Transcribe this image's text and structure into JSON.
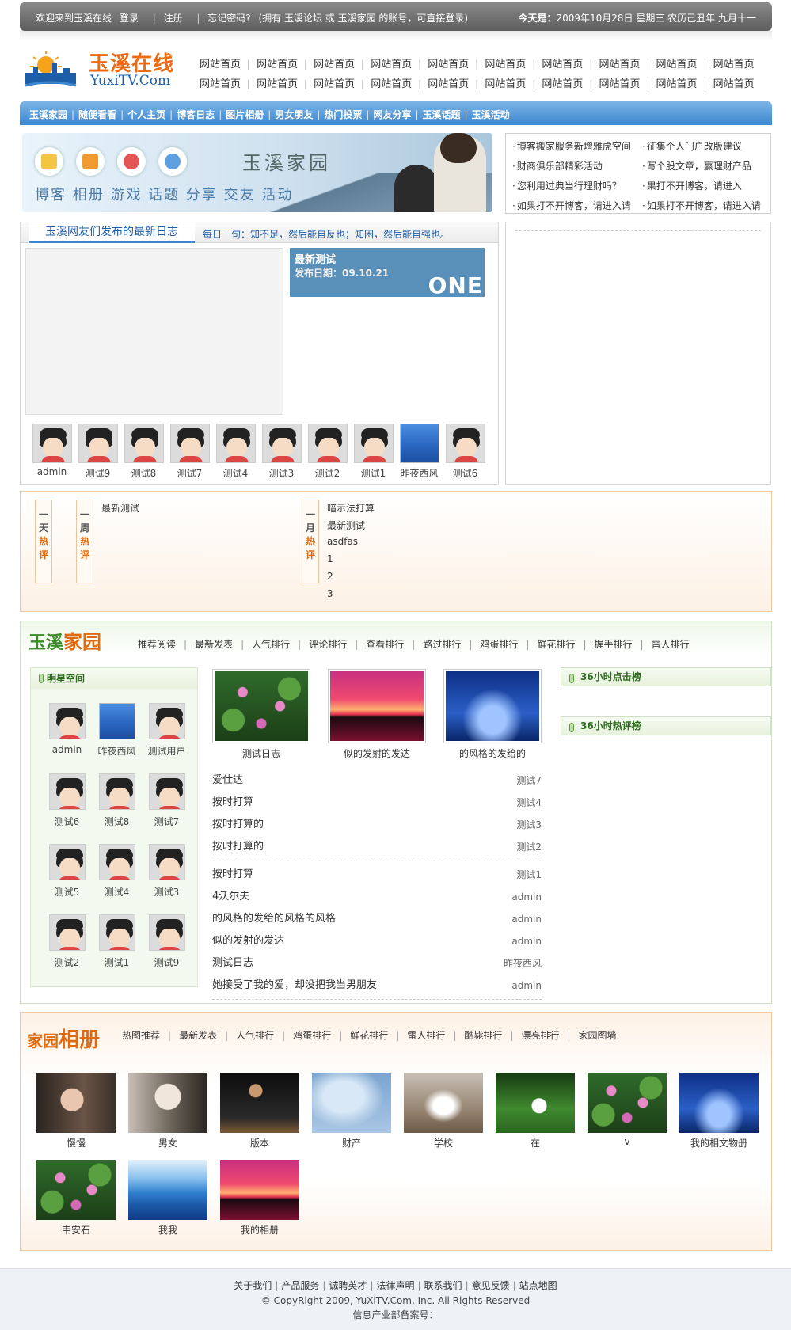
{
  "topbar": {
    "welcome": "欢迎来到玉溪在线",
    "login": "登录",
    "register": "注册",
    "forgot": "忘记密码?",
    "hint": "(拥有 玉溪论坛 或 玉溪家园 的账号，可直接登录)",
    "today_label": "今天是：",
    "today_value": "2009年10月28日 星期三 农历己丑年 九月十一"
  },
  "logo": {
    "cn": "玉溪在线",
    "en": "YuxiTV.Com"
  },
  "top_links": [
    [
      "网站首页",
      "网站首页",
      "网站首页",
      "网站首页",
      "网站首页",
      "网站首页",
      "网站首页",
      "网站首页",
      "网站首页",
      "网站首页"
    ],
    [
      "网站首页",
      "网站首页",
      "网站首页",
      "网站首页",
      "网站首页",
      "网站首页",
      "网站首页",
      "网站首页",
      "网站首页",
      "网站首页"
    ]
  ],
  "blue_nav": [
    "玉溪家园",
    "随便看看",
    "个人主页",
    "博客日志",
    "图片相册",
    "男女朋友",
    "热门投票",
    "网友分享",
    "玉溪话题",
    "玉溪活动"
  ],
  "banner": {
    "title": "玉溪家园",
    "words": "博客 相册 游戏 话题 分享 交友 活动"
  },
  "notice": {
    "left": [
      "博客搬家服务新增雅虎空间",
      "财商俱乐部精彩活动",
      "您利用过典当行理财吗？",
      "如果打不开博客，请进入请"
    ],
    "right": [
      "征集个人门户改版建议",
      "写个股文章，赢理财产品",
      "果打不开博客，请进入",
      "如果打不开博客，请进入请"
    ]
  },
  "latest": {
    "tab": "玉溪网友们发布的最新日志",
    "quote": "每日一句：知不足，然后能自反也；知困，然后能自强也。",
    "card_title": "最新测试",
    "card_date_label": "发布日期：",
    "card_date": "09.10.21",
    "card_badge": "ONE",
    "users": [
      {
        "name": "admin",
        "blue": false
      },
      {
        "name": "测试9",
        "blue": false
      },
      {
        "name": "测试8",
        "blue": false
      },
      {
        "name": "测试7",
        "blue": false
      },
      {
        "name": "测试4",
        "blue": false
      },
      {
        "name": "测试3",
        "blue": false
      },
      {
        "name": "测试2",
        "blue": false
      },
      {
        "name": "测试1",
        "blue": false
      },
      {
        "name": "昨夜西风",
        "blue": true
      },
      {
        "name": "测试6",
        "blue": false
      }
    ]
  },
  "hot": {
    "day_tag": [
      "一",
      "天",
      "热",
      "评"
    ],
    "week_tag": [
      "一",
      "周",
      "热",
      "评"
    ],
    "month_tag": [
      "一",
      "月",
      "热",
      "评"
    ],
    "week_list": [
      "最新测试"
    ],
    "month_list": [
      "暗示法打算",
      "最新测试",
      "asdfas",
      "1",
      "2",
      "3"
    ]
  },
  "home": {
    "logo_a": "玉溪",
    "logo_b": "家园",
    "tabs": [
      "推荐阅读",
      "最新发表",
      "人气排行",
      "评论排行",
      "查看排行",
      "路过排行",
      "鸡蛋排行",
      "鲜花排行",
      "握手排行",
      "雷人排行"
    ],
    "stars_title": "明星空间",
    "stars": [
      {
        "name": "admin",
        "blue": false
      },
      {
        "name": "昨夜西风",
        "blue": true
      },
      {
        "name": "测试用户",
        "blue": false
      },
      {
        "name": "测试6",
        "blue": false
      },
      {
        "name": "测试8",
        "blue": false
      },
      {
        "name": "测试7",
        "blue": false
      },
      {
        "name": "测试5",
        "blue": false
      },
      {
        "name": "测试4",
        "blue": false
      },
      {
        "name": "测试3",
        "blue": false
      },
      {
        "name": "测试2",
        "blue": false
      },
      {
        "name": "测试1",
        "blue": false
      },
      {
        "name": "测试9",
        "blue": false
      }
    ],
    "photos": [
      {
        "cap": "测试日志",
        "style": "lotus"
      },
      {
        "cap": "似的发射的发达",
        "style": "sunset"
      },
      {
        "cap": "的风格的发给的",
        "style": "bluefield"
      }
    ],
    "list_a": [
      {
        "t": "爱仕达",
        "a": "测试7"
      },
      {
        "t": "按时打算",
        "a": "测试4"
      },
      {
        "t": "按时打算的",
        "a": "测试3"
      },
      {
        "t": "按时打算的",
        "a": "测试2"
      }
    ],
    "list_b": [
      {
        "t": "按时打算",
        "a": "测试1"
      },
      {
        "t": "4沃尔夫",
        "a": "admin"
      },
      {
        "t": "的风格的发给的风格的风格",
        "a": "admin"
      },
      {
        "t": "似的发射的发达",
        "a": "admin"
      },
      {
        "t": "测试日志",
        "a": "昨夜西风"
      },
      {
        "t": "她接受了我的爱，却没把我当男朋友",
        "a": "admin"
      }
    ],
    "rank_click": "36小时点击榜",
    "rank_comment": "36小时热评榜"
  },
  "album": {
    "logo_a": "家园",
    "logo_b": "相册",
    "tabs": [
      "热图推荐",
      "最新发表",
      "人气排行",
      "鸡蛋排行",
      "鲜花排行",
      "雷人排行",
      "酷毙排行",
      "漂亮排行",
      "家园图墙"
    ],
    "items": [
      {
        "cap": "慢慢",
        "style": "girl1"
      },
      {
        "cap": "男女",
        "style": "girl2"
      },
      {
        "cap": "版本",
        "style": "dancer"
      },
      {
        "cap": "财产",
        "style": "sky"
      },
      {
        "cap": "学校",
        "style": "bride"
      },
      {
        "cap": "在",
        "style": "grass"
      },
      {
        "cap": "v",
        "style": "lotus"
      },
      {
        "cap": "我的相文物册",
        "style": "bluefield"
      },
      {
        "cap": "韦安石",
        "style": "lotus"
      },
      {
        "cap": "我我",
        "style": "mountains"
      },
      {
        "cap": "我的相册",
        "style": "sunset"
      }
    ]
  },
  "footer": {
    "links": [
      "关于我们",
      "产品服务",
      "诚聘英才",
      "法律声明",
      "联系我们",
      "意见反馈",
      "站点地图"
    ],
    "copy": "© CopyRight 2009, YuXiTV.Com, Inc. All Rights Reserved",
    "icp": "信息产业部备案号："
  },
  "colors": {
    "accent_blue": "#3b86cf",
    "accent_orange": "#e06a10",
    "green": "#3d8a2a"
  }
}
